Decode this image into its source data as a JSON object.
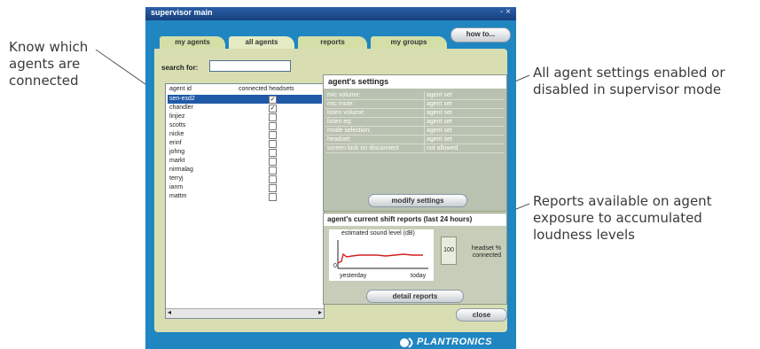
{
  "app": {
    "title": "supervisor main",
    "window_controls": "- ×",
    "tabs": [
      "my agents",
      "all agents",
      "reports",
      "my groups"
    ],
    "how_to_label": "how to...",
    "search": {
      "label": "search for:",
      "value": ""
    },
    "agent_table": {
      "headers": [
        "agent id",
        "connected headsets"
      ],
      "rows": [
        {
          "id": "sen-esd2",
          "connected": true,
          "selected": true
        },
        {
          "id": "chandler",
          "connected": true,
          "selected": false
        },
        {
          "id": "linjiez",
          "connected": false,
          "selected": false
        },
        {
          "id": "scotts",
          "connected": false,
          "selected": false
        },
        {
          "id": "nicke",
          "connected": false,
          "selected": false
        },
        {
          "id": "erinf",
          "connected": false,
          "selected": false
        },
        {
          "id": "johng",
          "connected": false,
          "selected": false
        },
        {
          "id": "markt",
          "connected": false,
          "selected": false
        },
        {
          "id": "nirmalag",
          "connected": false,
          "selected": false
        },
        {
          "id": "terryj",
          "connected": false,
          "selected": false
        },
        {
          "id": "ianm",
          "connected": false,
          "selected": false
        },
        {
          "id": "mattm",
          "connected": false,
          "selected": false
        }
      ],
      "scroll_left": "◂",
      "scroll_right": "▸"
    },
    "settings": {
      "title": "agent's settings",
      "rows": [
        {
          "name": "mic volume:",
          "value": "agent set"
        },
        {
          "name": "mic mute:",
          "value": "agent set"
        },
        {
          "name": "listen volume:",
          "value": "agent set"
        },
        {
          "name": "listen eq:",
          "value": "agent set"
        },
        {
          "name": "mode selection:",
          "value": "agent set"
        },
        {
          "name": "headset:",
          "value": "agent set"
        },
        {
          "name": "screen lock on disconnect",
          "value": "not allowed"
        }
      ],
      "modify_label": "modify settings"
    },
    "reports": {
      "title": "agent's current shift reports (last 24 hours)",
      "graph_title": "estimated sound level (dB)",
      "y_zero": "0",
      "x_start": "yesterday",
      "x_end": "today",
      "headset_connected_value": "100",
      "headset_connected_label": "headset % connected",
      "detail_label": "detail reports"
    },
    "close_label": "close",
    "brand": "PLANTRONICS"
  },
  "callouts": {
    "agents_connected": "Know which agents are connected",
    "settings_enabled": "All agent settings enabled or disabled in supervisor mode",
    "reports_available": "Reports available on agent exposure to accumulated loudness levels"
  },
  "colors": {
    "window_blue": "#1f86c2",
    "panel_green": "#d8deb2",
    "selected_row": "#1f5aa8",
    "graph_line": "#d22020"
  }
}
